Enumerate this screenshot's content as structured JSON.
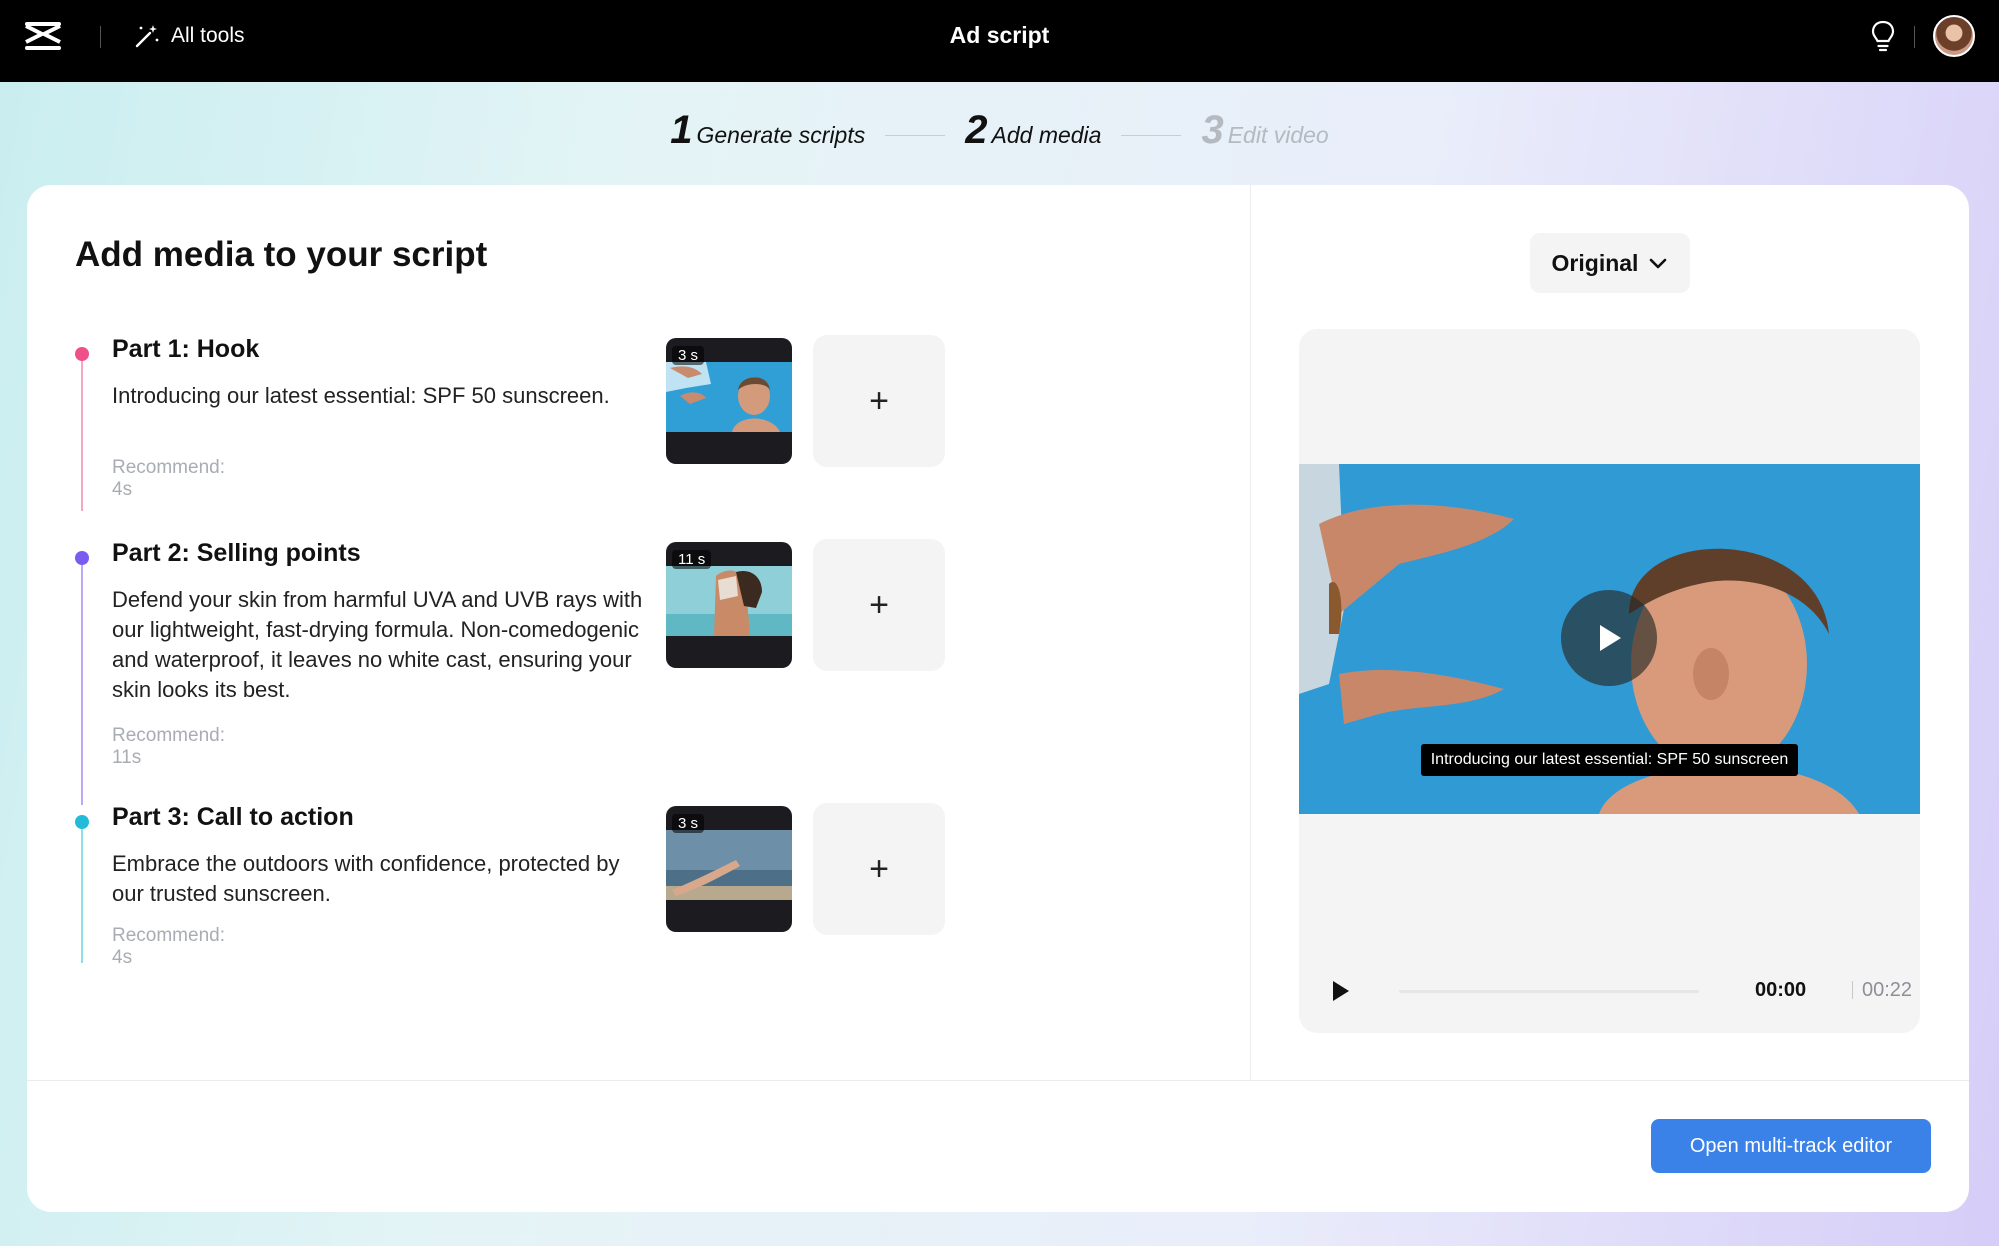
{
  "header": {
    "all_tools_label": "All tools",
    "title": "Ad script"
  },
  "stepper": {
    "steps": [
      {
        "number": "1",
        "label": "Generate scripts",
        "state": "done"
      },
      {
        "number": "2",
        "label": "Add media",
        "state": "active"
      },
      {
        "number": "3",
        "label": "Edit video",
        "state": "inactive"
      }
    ]
  },
  "main": {
    "title": "Add media to your script",
    "parts": [
      {
        "title": "Part 1: Hook",
        "text": "Introducing our latest essential: SPF 50 sunscreen.",
        "recommend": "Recommend: 4s",
        "duration": "3 s",
        "color": "#f0508a"
      },
      {
        "title": "Part 2: Selling points",
        "text": "Defend your skin from harmful UVA and UVB rays with our lightweight, fast-drying formula. Non-comedogenic and waterproof, it leaves no white cast, ensuring your skin looks its best.",
        "recommend": "Recommend: 11s",
        "duration": "11 s",
        "color": "#7b5cf0"
      },
      {
        "title": "Part 3: Call to action",
        "text": "Embrace the outdoors with confidence, protected by our trusted sunscreen.",
        "recommend": "Recommend: 4s",
        "duration": "3 s",
        "color": "#22bcd9"
      }
    ],
    "add_label": "+"
  },
  "preview": {
    "ratio_select": "Original",
    "caption": "Introducing our latest essential: SPF 50 sunscreen",
    "time_current": "00:00",
    "time_total": "00:22",
    "progress": 0
  },
  "footer": {
    "open_editor_label": "Open multi-track editor"
  },
  "colors": {
    "accent": "#3b82e8",
    "topbar": "#000000"
  }
}
